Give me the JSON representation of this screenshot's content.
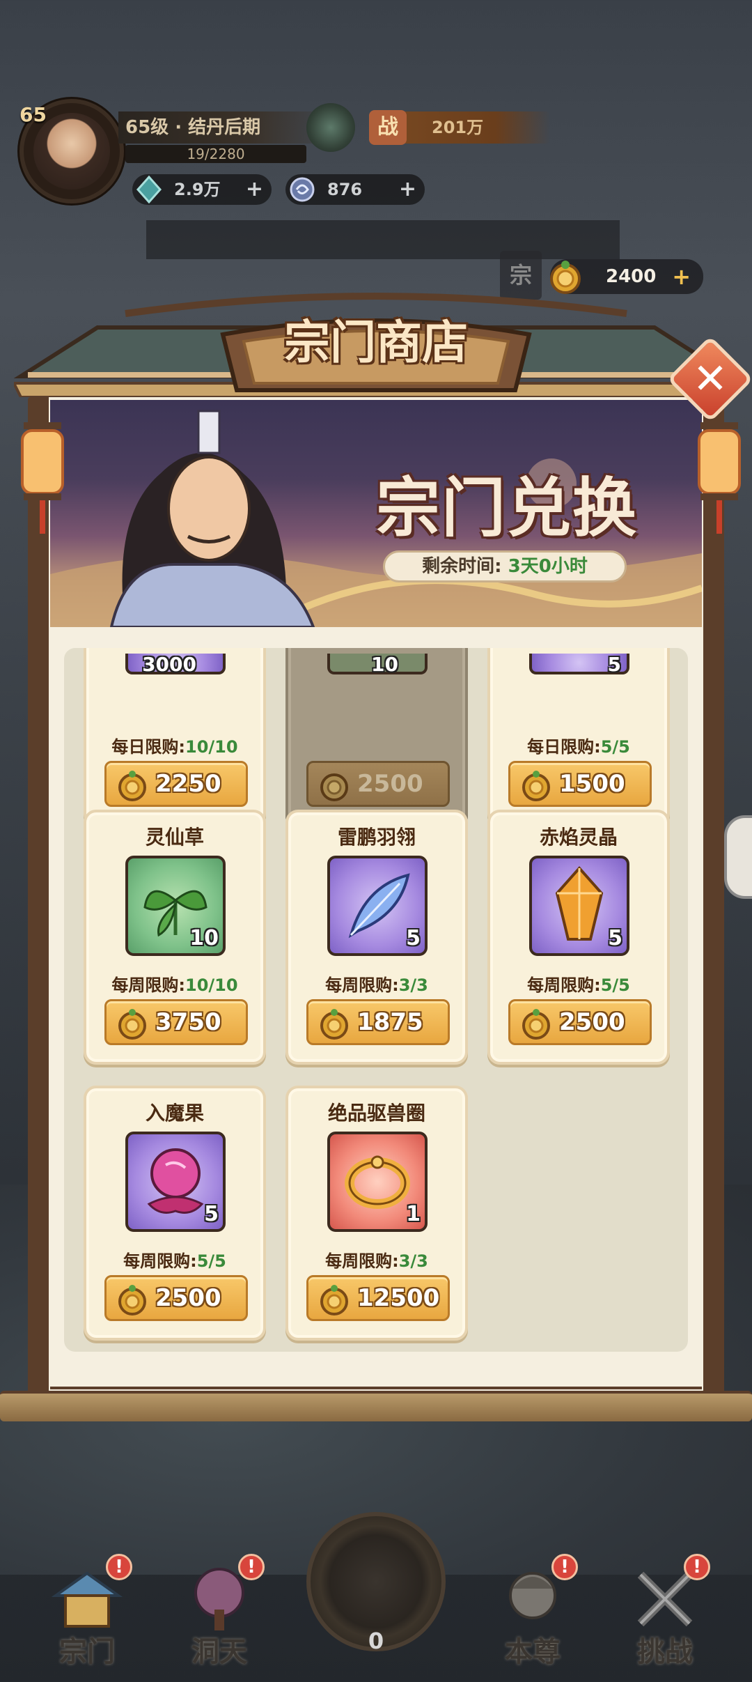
{
  "player": {
    "level": "65",
    "title": "65级 · 结丹后期",
    "exp": "19/2280",
    "power_icon": "战",
    "power": "201万",
    "diamonds": "2.9万",
    "spirit": "876",
    "plus": "+"
  },
  "shop": {
    "title": "宗门商店",
    "coin_balance": "2400",
    "coin_plus": "+",
    "side_tag": "宗",
    "banner_title": "宗门兑换",
    "remaining_label": "剩余时间:",
    "remaining_value": "3天0小时",
    "close_icon": "close-icon"
  },
  "partial_row": [
    {
      "count_above": "3000",
      "limit_label": "每日限购:",
      "limit_value": "10/10",
      "price": "2250",
      "sold_out": false
    },
    {
      "count_above": "10",
      "limit_label": "",
      "limit_value": "",
      "price": "2500",
      "sold_out": true
    },
    {
      "count_above": "5",
      "limit_label": "每日限购:",
      "limit_value": "5/5",
      "price": "1500",
      "sold_out": false
    }
  ],
  "items": [
    {
      "name": "灵仙草",
      "count": "10",
      "color": "green",
      "limit_label": "每周限购:",
      "limit_value": "10/10",
      "price": "3750",
      "icon": "herb-icon"
    },
    {
      "name": "雷鹏羽翎",
      "count": "5",
      "color": "purple",
      "limit_label": "每周限购:",
      "limit_value": "3/3",
      "price": "1875",
      "icon": "feather-icon"
    },
    {
      "name": "赤焰灵晶",
      "count": "5",
      "color": "purple",
      "limit_label": "每周限购:",
      "limit_value": "5/5",
      "price": "2500",
      "icon": "crystal-icon"
    },
    {
      "name": "入魔果",
      "count": "5",
      "color": "purple",
      "limit_label": "每周限购:",
      "limit_value": "5/5",
      "price": "2500",
      "icon": "fruit-icon"
    },
    {
      "name": "绝品驱兽圈",
      "count": "1",
      "color": "red",
      "limit_label": "每周限购:",
      "limit_value": "3/3",
      "price": "12500",
      "icon": "ring-icon"
    }
  ],
  "nav": {
    "items": [
      {
        "label": "宗门",
        "badge": "!"
      },
      {
        "label": "洞天",
        "badge": "!"
      },
      {
        "label": "本尊",
        "badge": "!"
      },
      {
        "label": "挑战",
        "badge": "!"
      }
    ],
    "center_count": "0"
  },
  "colors": {
    "accent_gold": "#e8a740",
    "limit_green": "#3a8a3a",
    "frame_brown": "#5b3e2a",
    "card_bg": "#f9f1da"
  }
}
